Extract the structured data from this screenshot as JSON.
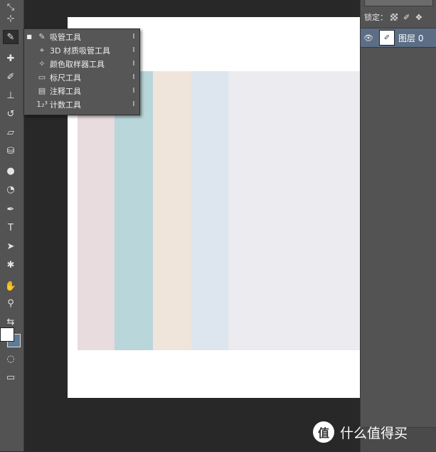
{
  "tools": [
    {
      "name": "slice-tool-icon",
      "glyph": "⤡"
    },
    {
      "name": "crop-tool-icon",
      "glyph": "⊹"
    },
    {
      "name": "eyedropper-tool-icon",
      "glyph": "✎"
    },
    {
      "name": "healing-brush-tool-icon",
      "glyph": "✚"
    },
    {
      "name": "brush-tool-icon",
      "glyph": "✐"
    },
    {
      "name": "clone-stamp-tool-icon",
      "glyph": "⊥"
    },
    {
      "name": "history-brush-tool-icon",
      "glyph": "↺"
    },
    {
      "name": "eraser-tool-icon",
      "glyph": "▱"
    },
    {
      "name": "paint-bucket-tool-icon",
      "glyph": "⛁"
    },
    {
      "name": "blur-tool-icon",
      "glyph": "●"
    },
    {
      "name": "dodge-tool-icon",
      "glyph": "◔"
    },
    {
      "name": "pen-tool-icon",
      "glyph": "✒"
    },
    {
      "name": "type-tool-icon",
      "glyph": "T"
    },
    {
      "name": "path-selection-tool-icon",
      "glyph": "➤"
    },
    {
      "name": "custom-shape-tool-icon",
      "glyph": "✱"
    },
    {
      "name": "hand-tool-icon",
      "glyph": "✋"
    },
    {
      "name": "zoom-tool-icon",
      "glyph": "⚲"
    },
    {
      "name": "default-colors-icon",
      "glyph": "⇆"
    },
    {
      "name": "quick-mask-icon",
      "glyph": "◌"
    },
    {
      "name": "screen-mode-icon",
      "glyph": "▭"
    }
  ],
  "flyout": {
    "items": [
      {
        "label": "吸管工具",
        "key": "I",
        "icon": "eyedropper-icon",
        "glyph": "✎",
        "selected": true
      },
      {
        "label": "3D 材质吸管工具",
        "key": "I",
        "icon": "3d-material-eyedropper-icon",
        "glyph": "⌖",
        "selected": false
      },
      {
        "label": "颜色取样器工具",
        "key": "I",
        "icon": "color-sampler-icon",
        "glyph": "✧",
        "selected": false
      },
      {
        "label": "标尺工具",
        "key": "I",
        "icon": "ruler-icon",
        "glyph": "▭",
        "selected": false
      },
      {
        "label": "注释工具",
        "key": "I",
        "icon": "note-icon",
        "glyph": "▤",
        "selected": false
      },
      {
        "label": "计数工具",
        "key": "I",
        "icon": "count-icon",
        "glyph": "1₂³",
        "selected": false
      }
    ]
  },
  "layers_panel": {
    "lock_label": "锁定：",
    "layer_name": "图层 0"
  },
  "colors": {
    "foreground": "#ffffff",
    "background": "#5e7a94",
    "strips": [
      "#e8dcde",
      "#b9d6da",
      "#f0e5da",
      "#dde6ee",
      "#ecebef"
    ]
  },
  "watermark": {
    "logo_glyph": "值",
    "text": "什么值得买"
  }
}
